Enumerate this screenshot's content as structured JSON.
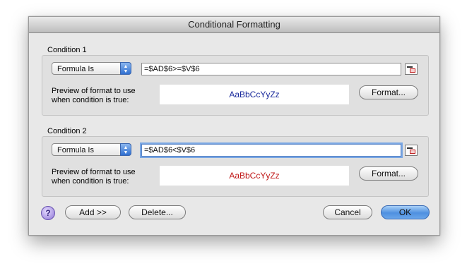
{
  "window": {
    "title": "Conditional Formatting"
  },
  "conditions": [
    {
      "label": "Condition 1",
      "type": "Formula Is",
      "formula": "=$AD$6>=$V$6",
      "preview_label_line1": "Preview of format to use",
      "preview_label_line2": "when condition is true:",
      "preview_text": "AaBbCcYyZz",
      "preview_color": "#1a2a9c",
      "format_button": "Format..."
    },
    {
      "label": "Condition 2",
      "type": "Formula Is",
      "formula": "=$AD$6<$V$6",
      "preview_label_line1": "Preview of format to use",
      "preview_label_line2": "when condition is true:",
      "preview_text": "AaBbCcYyZz",
      "preview_color": "#c01818",
      "format_button": "Format..."
    }
  ],
  "footer": {
    "help_icon": "help-icon",
    "add_button": "Add >>",
    "delete_button": "Delete...",
    "cancel_button": "Cancel",
    "ok_button": "OK"
  },
  "colors": {
    "accent": "#4f90e0"
  }
}
